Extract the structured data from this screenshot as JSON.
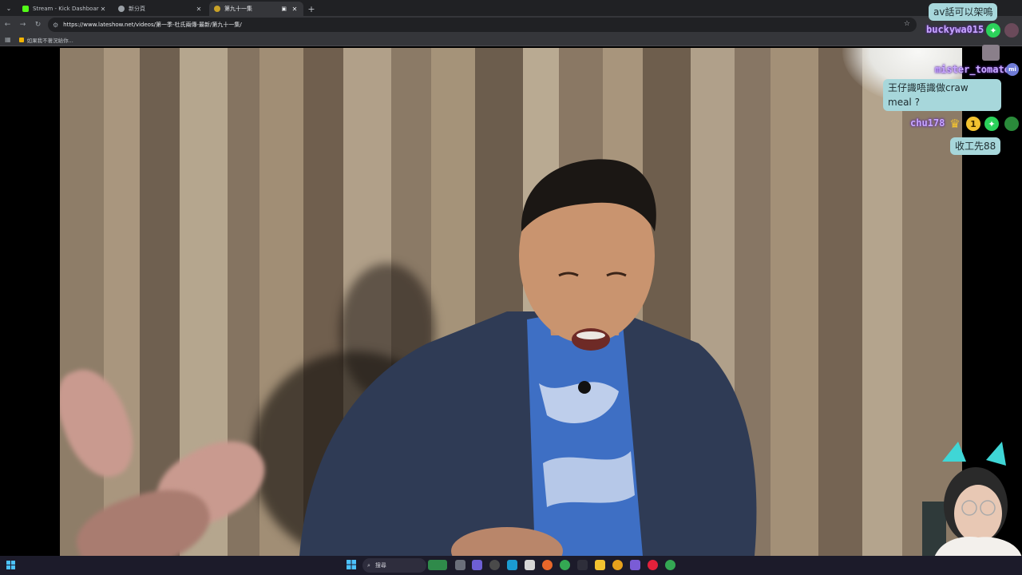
{
  "browser": {
    "tabs": [
      {
        "label": "Stream - Kick Dashboard",
        "favicon_color": "#53fc18",
        "active": false
      },
      {
        "label": "新分頁",
        "favicon_color": "#9aa0a6",
        "active": false
      },
      {
        "label": "第九十一集",
        "favicon_color": "#8ab4f8",
        "active": true
      }
    ],
    "url": "https://www.lateshow.net/videos/第一季-杜氏兩傳-最新/第九十一集/",
    "bookmark": "如果我不著況給你..."
  },
  "chat": {
    "messages": [
      {
        "user": "",
        "text": "av話可以架嗚"
      },
      {
        "user": "buckywa015",
        "text": ""
      },
      {
        "user": "mister_tomato",
        "text": "王仔識唔識做craw meal ?"
      },
      {
        "user": "chu178",
        "text": "收工先88"
      }
    ],
    "msg3_line1": "王仔識唔識做craw",
    "msg3_line2": "meal ?",
    "badge_number": "1"
  },
  "taskbar": {
    "search_placeholder": "搜尋"
  },
  "colors": {
    "chat_bubble": "#a7d7db",
    "username": "#c8a9ff",
    "badge_green": "#2bd15a",
    "badge_gold": "#f2c230"
  }
}
